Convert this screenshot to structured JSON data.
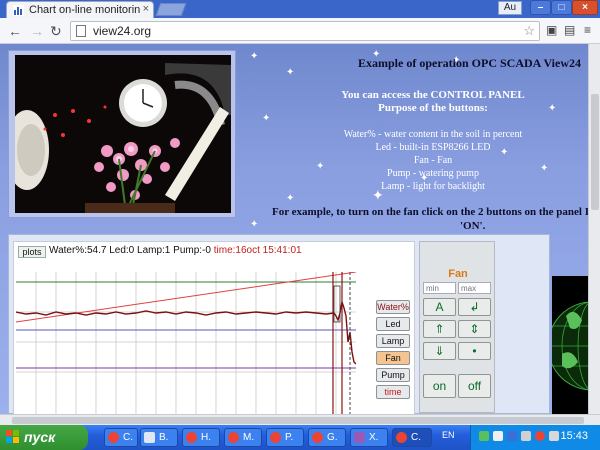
{
  "browser": {
    "tab_title": "Chart on-line monitorin",
    "tab_close": "×",
    "user_badge": "Au",
    "url": "view24.org",
    "win_min": "–",
    "win_max": "□",
    "win_close": "×"
  },
  "intro": {
    "title": "Example of operation OPC SCADA View24",
    "access": "You can access the CONTROL PANEL",
    "purpose": "Purpose of the buttons:",
    "items": [
      "Water% - water content in the soil in percent",
      "Led - built-in ESP8266 LED",
      "Fan - Fan",
      "Pump - watering pump",
      "Lamp - light for backlight"
    ],
    "example": "For example, to turn on the fan click on the 2 buttons on the panel I",
    "example_on": "'ON'."
  },
  "panel": {
    "plots_label": "plots",
    "status": "Water%:54.7 Led:0 Lamp:1 Pump:-0",
    "status_time": "time:16oct 15:41:01",
    "series_buttons": [
      "Water%",
      "Led",
      "Lamp",
      "Fan",
      "Pump",
      "time"
    ]
  },
  "control": {
    "title": "Fan",
    "min_placeholder": "min",
    "max_placeholder": "max",
    "buttons": [
      "A",
      "↲",
      "⇑",
      "⇕",
      "⇓",
      "•"
    ],
    "on": "on",
    "off": "off"
  },
  "taskbar": {
    "start": "пуск",
    "items": [
      "C.",
      "B.",
      "H.",
      "M.",
      "P.",
      "G.",
      "X.",
      "C."
    ],
    "lang": "EN",
    "clock": "15:43"
  },
  "colors": {
    "accent_fan": "#d97a16",
    "water_series": "#7a1010",
    "time_text": "#c0201c"
  }
}
